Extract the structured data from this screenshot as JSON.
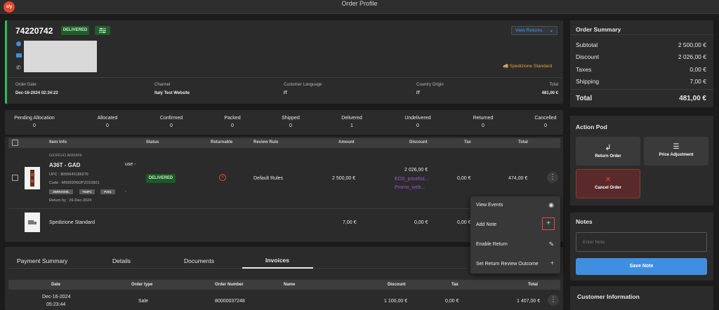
{
  "window": {
    "title": "Order Profile",
    "logo_text": "x/y"
  },
  "order": {
    "id": "74220742",
    "status_badge": "DELIVERED",
    "view_returns_label": "View Returns",
    "shipping_method": "Spedizione Standard",
    "headers": [
      {
        "label": "Order Date",
        "value": "Dec-16-2024 02:34:22"
      },
      {
        "label": "Channel",
        "value": "Italy Test Website"
      },
      {
        "label": "Customer Language",
        "value": "IT"
      },
      {
        "label": "Country Origin",
        "value": "IT"
      },
      {
        "label": "Total",
        "value": "481,00 €"
      }
    ]
  },
  "statuses": [
    {
      "label": "Pending Allocation",
      "count": "0"
    },
    {
      "label": "Allocated",
      "count": "0"
    },
    {
      "label": "Confirmed",
      "count": "0"
    },
    {
      "label": "Packed",
      "count": "0"
    },
    {
      "label": "Shipped",
      "count": "0"
    },
    {
      "label": "Delivered",
      "count": "1"
    },
    {
      "label": "Undelivered",
      "count": "0"
    },
    {
      "label": "Returned",
      "count": "0"
    },
    {
      "label": "Cancelled",
      "count": "0"
    }
  ],
  "items_table": {
    "headers": [
      "Item Info",
      "Status",
      "Returnable",
      "Review Rule",
      "Amount",
      "Discount",
      "Tax",
      "Total"
    ],
    "item": {
      "brand": "GIORGIO ARMANI",
      "name": "A36T - GAD",
      "upc": "UPC : 8056643186276",
      "code": "Code : M00000NI2PZ010501",
      "chips": [
        "3WHVA00L",
        "T84P1",
        "PZ01"
      ],
      "return_by": "Return by : 26-Dec-2024",
      "use_label": "use -",
      "dash": "-",
      "status": "DELIVERED",
      "review_rule": "Default Rules",
      "amount": "2 500,00 €",
      "discount": "2 026,00 €",
      "discount_links": [
        "EOS_pricelist...",
        "Promo_web..."
      ],
      "tax": "0,00 €",
      "total": "474,00 €"
    },
    "shipping": {
      "name": "Spedizione Standard",
      "amount": "7,00 €",
      "discount": "0,00 €",
      "tax": "0,00 €"
    }
  },
  "context_menu": {
    "items": [
      {
        "label": "View Events",
        "icon": "eye-icon",
        "glyph": "👁"
      },
      {
        "label": "Add Note",
        "icon": "plus-icon",
        "glyph": "+"
      },
      {
        "label": "Enable Return",
        "icon": "pencil-icon",
        "glyph": "✎"
      },
      {
        "label": "Set Return Review Outcome",
        "icon": "plus-icon",
        "glyph": "+"
      }
    ]
  },
  "tabs": [
    "Payment Summary",
    "Details",
    "Documents",
    "Invoices"
  ],
  "active_tab": "Invoices",
  "invoice_table": {
    "headers": [
      "Date",
      "Order type",
      "Order Number",
      "Name",
      "Discount",
      "Tax",
      "Total"
    ],
    "row": {
      "date": "Dec-16-2024",
      "date2": "05:23:44",
      "type": "Sale",
      "number": "80000037248",
      "discount": "1 100,00 €",
      "tax": "0,00 €",
      "total": "1 407,00 €"
    }
  },
  "summary": {
    "title": "Order Summary",
    "rows": [
      {
        "label": "Subtotal",
        "value": "2 500,00 €"
      },
      {
        "label": "Discount",
        "value": "2 026,00 €"
      },
      {
        "label": "Taxes",
        "value": "0,00 €"
      },
      {
        "label": "Shipping",
        "value": "7,00 €"
      }
    ],
    "total_label": "Total",
    "total_value": "481,00 €"
  },
  "action_pod": {
    "title": "Action Pod",
    "return_order": "Return Order",
    "price_adjustment": "Price Adjustment",
    "cancel_order": "Cancel Order"
  },
  "notes": {
    "title": "Notes",
    "placeholder": "Enter Note",
    "save_label": "Save Note"
  },
  "customer_info": {
    "title": "Customer Information"
  },
  "colors": {
    "accent": "#3f8fe0",
    "success": "#1e5e2a",
    "danger": "#e34848",
    "link": "#9b59d0"
  }
}
